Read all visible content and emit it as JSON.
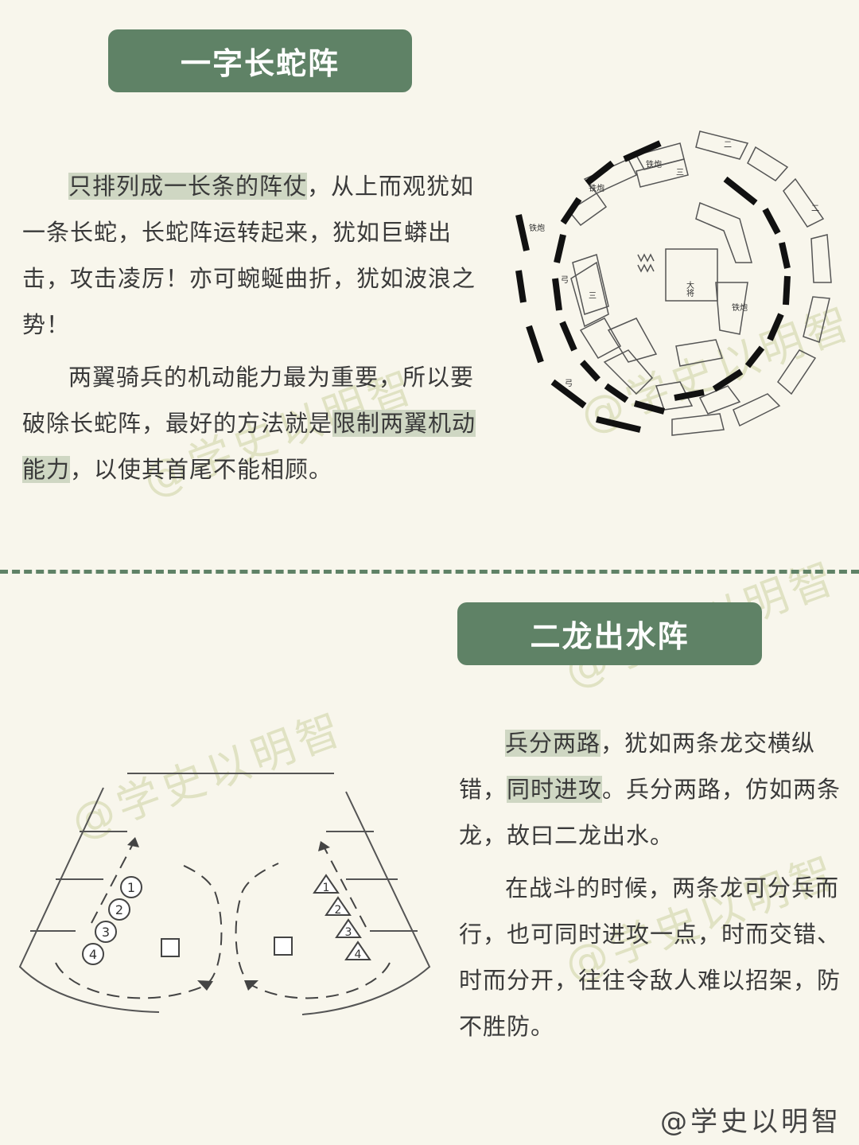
{
  "section1": {
    "title": "一字长蛇阵",
    "para1_highlight": "只排列成一长条的阵仗",
    "para1_rest": "，从上而观犹如一条长蛇，长蛇阵运转起来，犹如巨蟒出击，攻击凌厉！亦可蜿蜒曲折，犹如波浪之势！",
    "para2_pre": "两翼骑兵的机动能力最为重要，所以要破除长蛇阵，最好的方法就是",
    "para2_highlight": "限制两翼机动能力",
    "para2_post": "，以使其首尾不能相顾。"
  },
  "section2": {
    "title": "二龙出水阵",
    "para1_hl1": "兵分两路",
    "para1_mid": "，犹如两条龙交横纵错，",
    "para1_hl2": "同时进攻",
    "para1_post": "。兵分两路，仿如两条龙，故曰二龙出水。",
    "para2": "在战斗的时候，两条龙可分兵而行，也可同时进攻一点，时而交错、时而分开，往往令敌人难以招架，防不胜防。"
  },
  "diagram1": {
    "center_label": "大将",
    "ring_labels": [
      "铁炮",
      "二",
      "三",
      "铁炮",
      "二",
      "铁炮",
      "三",
      "弓",
      "铁炮",
      "弓"
    ]
  },
  "diagram2": {
    "left_markers": [
      "1",
      "2",
      "3",
      "4"
    ],
    "right_markers": [
      "1",
      "2",
      "3",
      "4"
    ]
  },
  "watermark": "@学史以明智"
}
